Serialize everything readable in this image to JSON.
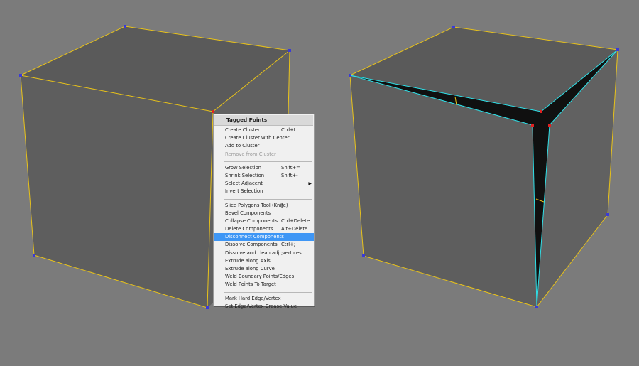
{
  "scene": {
    "background": "#7b7b7b",
    "face_color": "#5f5f5f",
    "edge_color": "#e8c21a",
    "cut_edge_color": "#2ee0e8",
    "vertex_color": "#3a3ad8",
    "selected_vertex_color": "#e02020",
    "gap_color": "#101010"
  },
  "context_menu": {
    "header": "Tagged Points",
    "groups": [
      [
        {
          "label": "Create Cluster",
          "shortcut": "Ctrl+L"
        },
        {
          "label": "Create Cluster with Center",
          "shortcut": ""
        },
        {
          "label": "Add to Cluster",
          "shortcut": ""
        },
        {
          "label": "Remove from Cluster",
          "shortcut": "",
          "disabled": true
        }
      ],
      [
        {
          "label": "Grow Selection",
          "shortcut": "Shift+="
        },
        {
          "label": "Shrink Selection",
          "shortcut": "Shift+-"
        },
        {
          "label": "Select Adjacent",
          "shortcut": "",
          "submenu": true
        },
        {
          "label": "Invert Selection",
          "shortcut": ""
        }
      ],
      [
        {
          "label": "Slice Polygons Tool (Knife)",
          "shortcut": "["
        },
        {
          "label": "Bevel Components",
          "shortcut": ""
        },
        {
          "label": "Collapse Components",
          "shortcut": "Ctrl+Delete"
        },
        {
          "label": "Delete Components",
          "shortcut": "Alt+Delete"
        },
        {
          "label": "Disconnect Components",
          "shortcut": "",
          "highlighted": true
        },
        {
          "label": "Dissolve Components",
          "shortcut": "Ctrl+;"
        },
        {
          "label": "Dissolve and clean adj. vertices",
          "shortcut": ";"
        },
        {
          "label": "Extrude along Axis",
          "shortcut": ""
        },
        {
          "label": "Extrude along Curve",
          "shortcut": ""
        },
        {
          "label": "Weld Boundary Points/Edges",
          "shortcut": ""
        },
        {
          "label": "Weld Points To Target",
          "shortcut": ""
        }
      ],
      [
        {
          "label": "Mark Hard Edge/Vertex",
          "shortcut": ""
        },
        {
          "label": "Set Edge/Vertex Crease Value",
          "shortcut": ""
        }
      ]
    ]
  }
}
